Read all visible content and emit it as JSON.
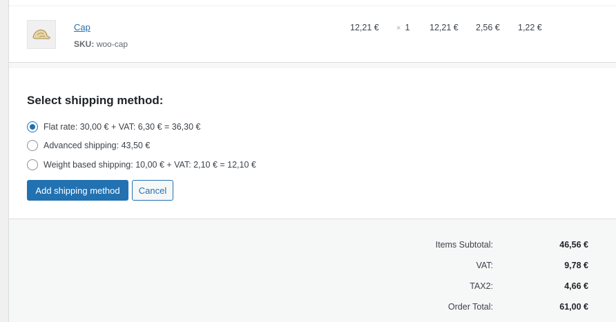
{
  "item": {
    "name": "Cap",
    "sku_label": "SKU:",
    "sku": "woo-cap",
    "cost": "12,21 €",
    "qty_symbol": "×",
    "qty": "1",
    "total": "12,21 €",
    "tax1": "2,56 €",
    "tax2": "1,22 €",
    "thumb_icon": "cap-icon"
  },
  "shipping": {
    "title": "Select shipping method:",
    "options": [
      {
        "label": "Flat rate: 30,00 € + VAT: 6,30 € = 36,30 €",
        "checked": true
      },
      {
        "label": "Advanced shipping: 43,50 €",
        "checked": false
      },
      {
        "label": "Weight based shipping: 10,00 € + VAT: 2,10 € = 12,10 €",
        "checked": false
      }
    ],
    "add_label": "Add shipping method",
    "cancel_label": "Cancel"
  },
  "totals": [
    {
      "label": "Items Subtotal:",
      "value": "46,56 €"
    },
    {
      "label": "VAT:",
      "value": "9,78 €"
    },
    {
      "label": "TAX2:",
      "value": "4,66 €"
    },
    {
      "label": "Order Total:",
      "value": "61,00 €"
    }
  ],
  "colors": {
    "accent": "#2271b1",
    "text": "#3c434a",
    "border": "#dcdcde"
  }
}
